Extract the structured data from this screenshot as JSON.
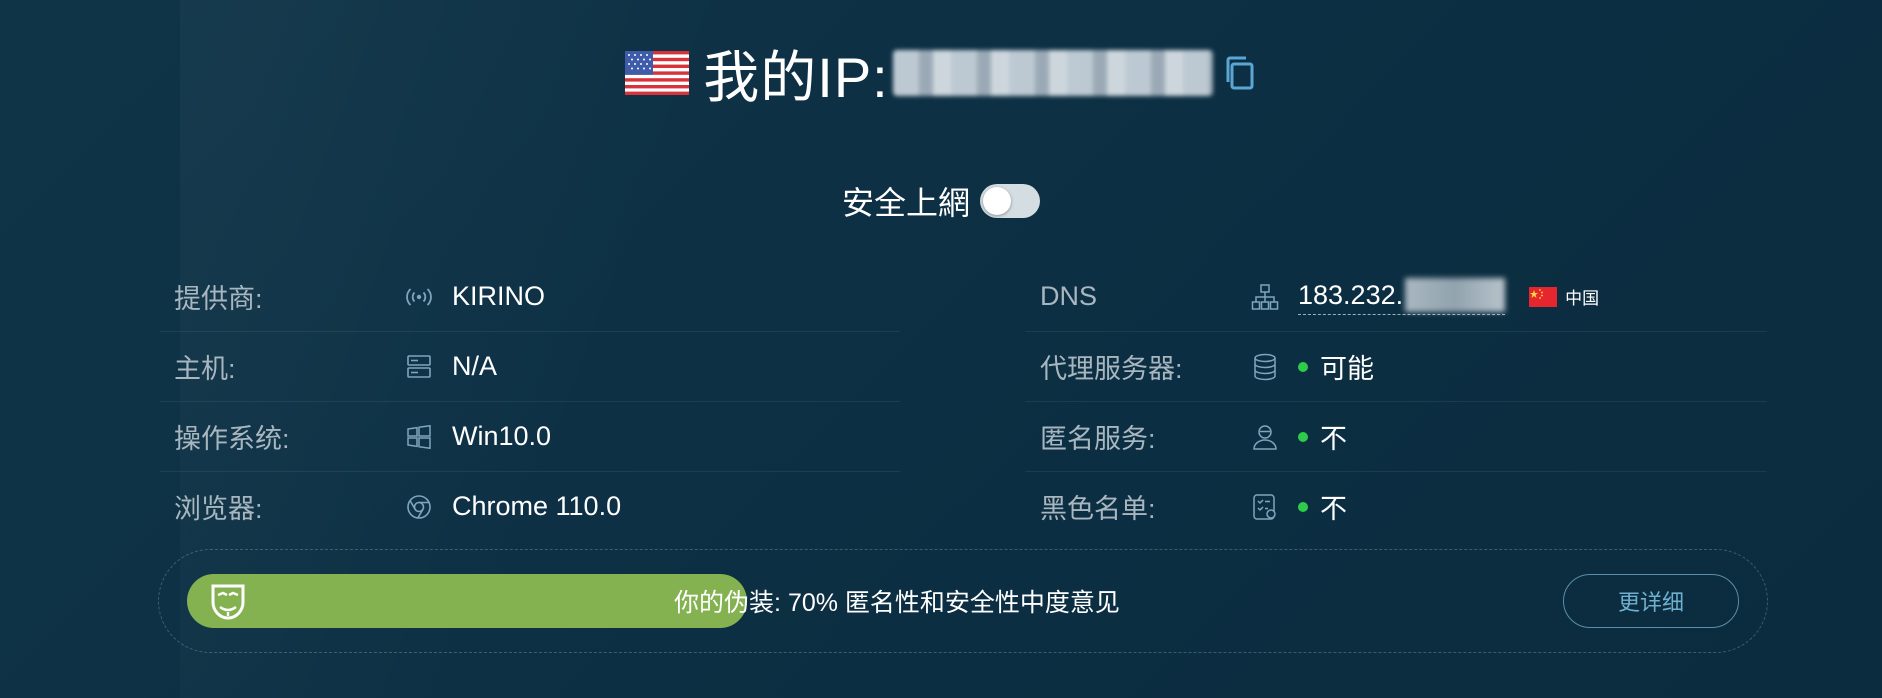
{
  "header": {
    "title_prefix": "我的IP:",
    "flag": "us-flag-icon",
    "copy_icon": "copy-icon"
  },
  "secure": {
    "label": "安全上網",
    "enabled": false
  },
  "left_rows": [
    {
      "label": "提供商:",
      "icon": "signal-icon",
      "value": "KIRINO"
    },
    {
      "label": "主机:",
      "icon": "server-icon",
      "value": "N/A"
    },
    {
      "label": "操作系统:",
      "icon": "windows-icon",
      "value": "Win10.0"
    },
    {
      "label": "浏览器:",
      "icon": "chrome-icon",
      "value": "Chrome 110.0"
    }
  ],
  "right_rows": [
    {
      "label": "DNS",
      "icon": "network-icon",
      "value": "183.232.",
      "country": "中国",
      "country_flag": "cn-flag-icon"
    },
    {
      "label": "代理服务器:",
      "icon": "database-icon",
      "value": "可能",
      "status_color": "#2ecc4a"
    },
    {
      "label": "匿名服务:",
      "icon": "user-icon",
      "value": "不",
      "status_color": "#2ecc4a"
    },
    {
      "label": "黑色名单:",
      "icon": "checklist-icon",
      "value": "不",
      "status_color": "#2ecc4a"
    }
  ],
  "disguise": {
    "text": "你的伪装: 70% 匿名性和安全性中度意见",
    "percent": 70,
    "fill_color": "#84b251",
    "icon": "mask-icon",
    "button_label": "更详细"
  }
}
